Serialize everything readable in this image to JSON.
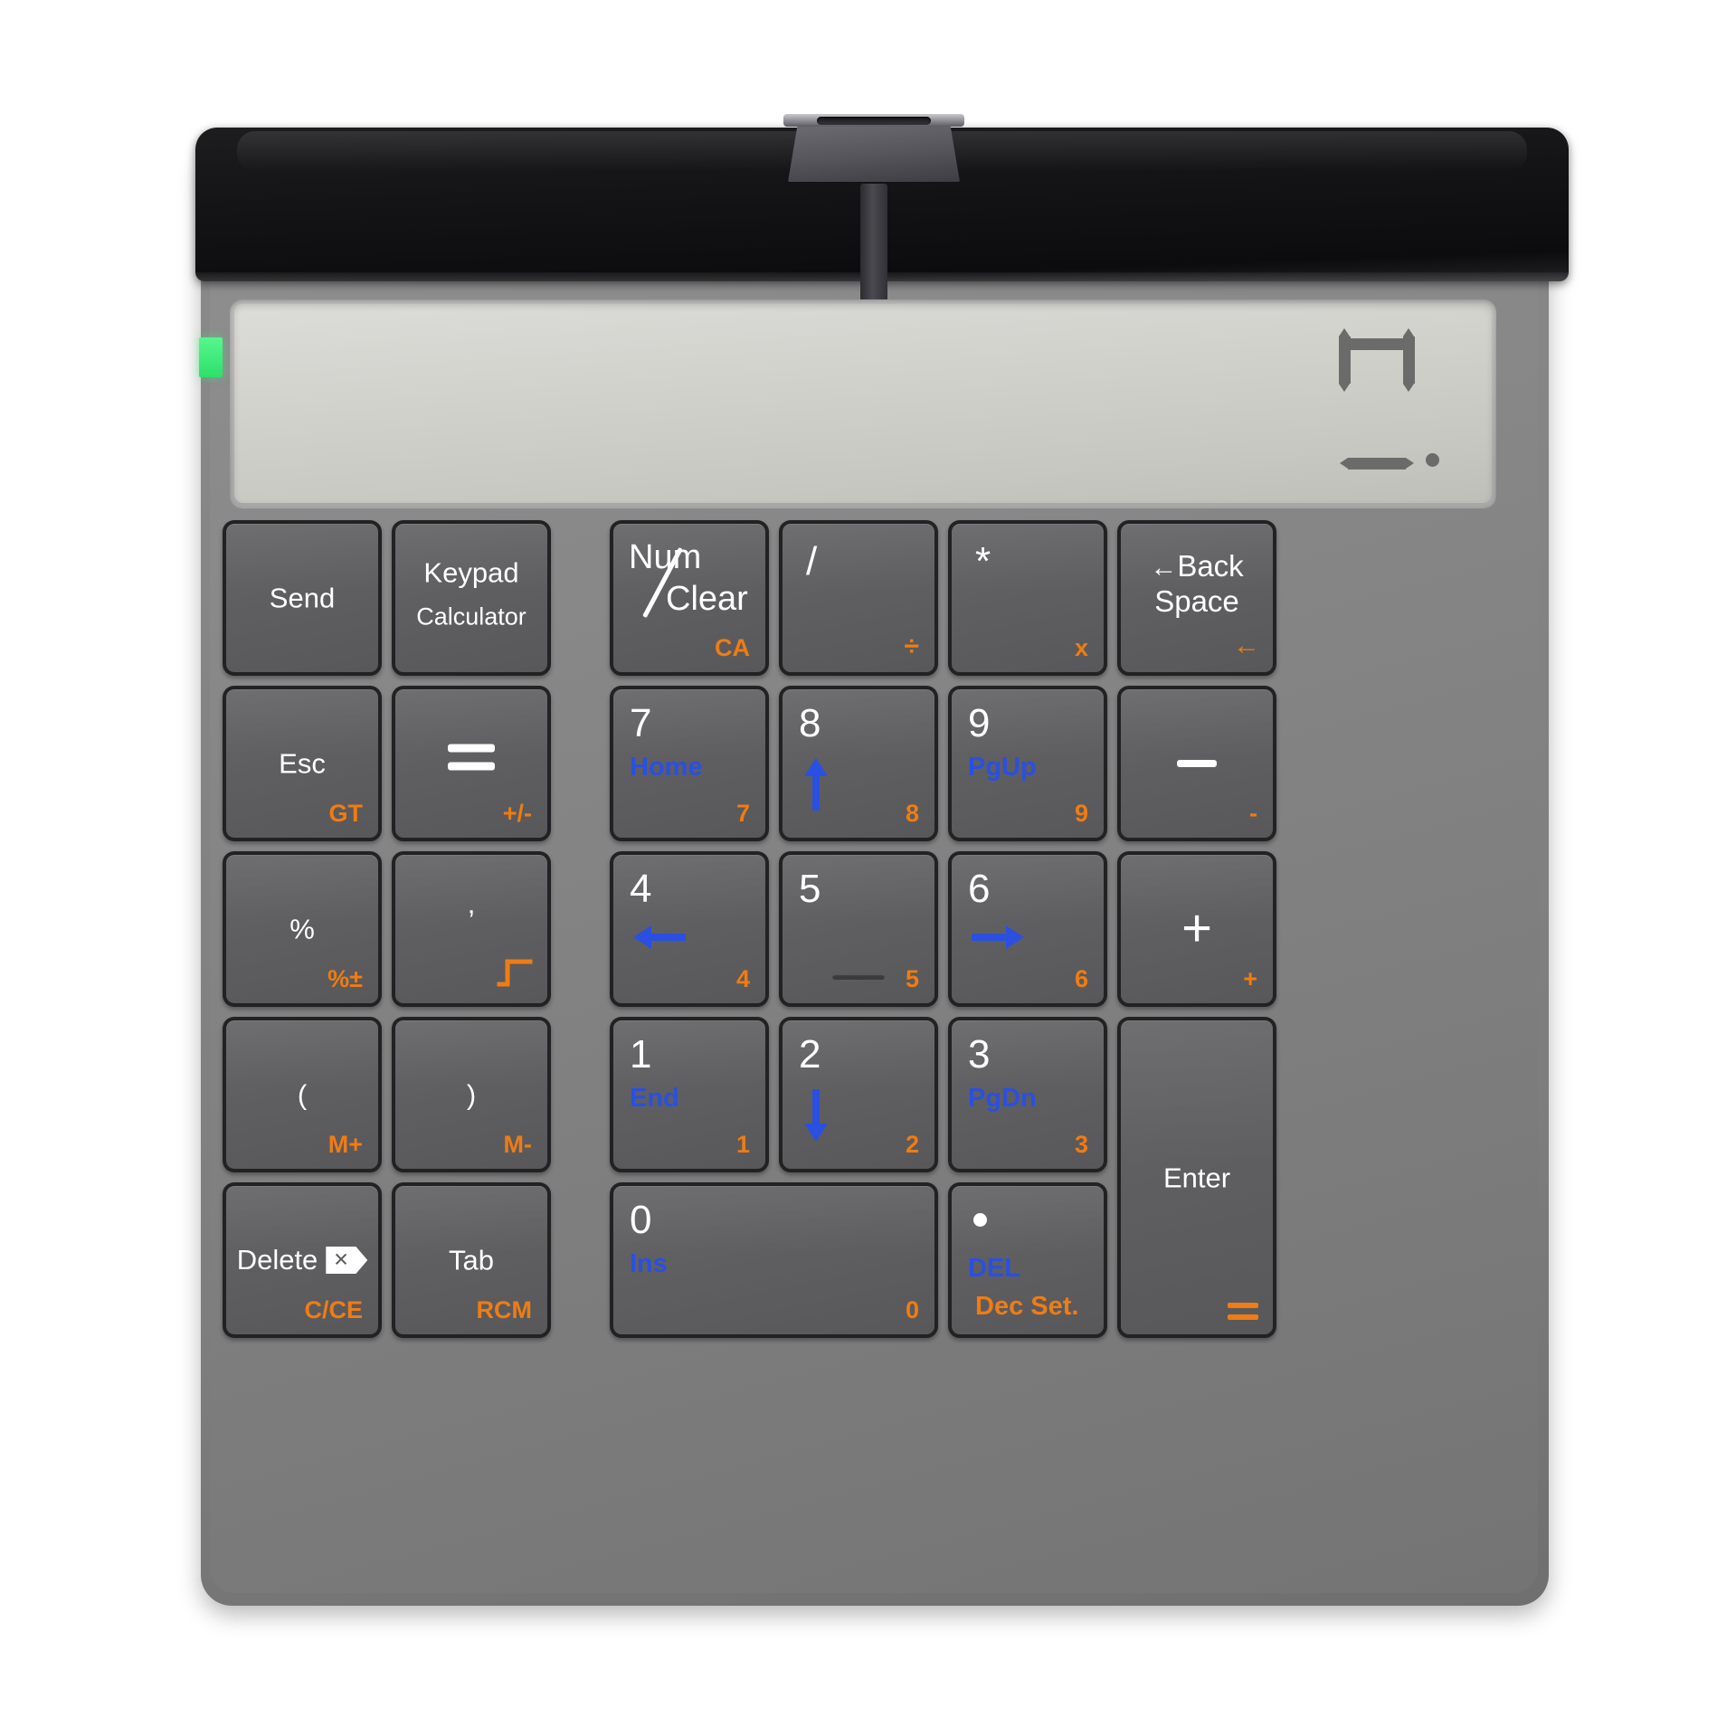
{
  "device": {
    "type": "wireless-numeric-keypad-calculator",
    "power_led_color": "#2ee06a",
    "accent_orange": "#ef7c14",
    "accent_blue": "#2b4fe0",
    "key_face_color": "#5f5f61",
    "body_color": "#848484",
    "top_panel_color": "#141416"
  },
  "display": {
    "value": "0",
    "decimal_point": ".",
    "segment_color": "#6b6b6b",
    "lcd_background": "#d2d2cd"
  },
  "keys": {
    "left_column": [
      {
        "id": "send",
        "primary": "Send",
        "secondary": "",
        "orange": "",
        "blue": ""
      },
      {
        "id": "keypad",
        "primary": "Keypad",
        "secondary": "Calculator",
        "orange": "",
        "blue": ""
      },
      {
        "id": "esc",
        "primary": "Esc",
        "secondary": "",
        "orange": "GT",
        "blue": ""
      },
      {
        "id": "equals",
        "primary": "=",
        "secondary": "",
        "orange": "+/-",
        "blue": ""
      },
      {
        "id": "percent",
        "primary": "%",
        "secondary": "",
        "orange": "%±",
        "blue": ""
      },
      {
        "id": "comma",
        "primary": ",",
        "secondary": "",
        "orange": "√",
        "blue": ""
      },
      {
        "id": "paren-open",
        "primary": "(",
        "secondary": "",
        "orange": "M+",
        "blue": ""
      },
      {
        "id": "paren-close",
        "primary": ")",
        "secondary": "",
        "orange": "M-",
        "blue": ""
      },
      {
        "id": "delete",
        "primary": "Delete",
        "secondary": "",
        "orange": "C/CE",
        "blue": ""
      },
      {
        "id": "tab",
        "primary": "Tab",
        "secondary": "",
        "orange": "RCM",
        "blue": ""
      }
    ],
    "keypad": [
      {
        "id": "num-clear",
        "primary": "Num",
        "secondary": "Clear",
        "orange": "CA",
        "blue": ""
      },
      {
        "id": "divide",
        "primary": "/",
        "secondary": "",
        "orange": "÷",
        "blue": ""
      },
      {
        "id": "multiply",
        "primary": "*",
        "secondary": "",
        "orange": "x",
        "blue": ""
      },
      {
        "id": "backspace",
        "primary": "Back",
        "secondary": "Space",
        "orange": "←",
        "blue": ""
      },
      {
        "id": "num7",
        "primary": "7",
        "secondary": "",
        "orange": "7",
        "blue": "Home"
      },
      {
        "id": "num8",
        "primary": "8",
        "secondary": "",
        "orange": "8",
        "blue": "↑"
      },
      {
        "id": "num9",
        "primary": "9",
        "secondary": "",
        "orange": "9",
        "blue": "PgUp"
      },
      {
        "id": "minus",
        "primary": "−",
        "secondary": "",
        "orange": "-",
        "blue": ""
      },
      {
        "id": "num4",
        "primary": "4",
        "secondary": "",
        "orange": "4",
        "blue": "←"
      },
      {
        "id": "num5",
        "primary": "5",
        "secondary": "",
        "orange": "5",
        "blue": ""
      },
      {
        "id": "num6",
        "primary": "6",
        "secondary": "",
        "orange": "6",
        "blue": "→"
      },
      {
        "id": "plus",
        "primary": "+",
        "secondary": "",
        "orange": "+",
        "blue": ""
      },
      {
        "id": "num1",
        "primary": "1",
        "secondary": "",
        "orange": "1",
        "blue": "End"
      },
      {
        "id": "num2",
        "primary": "2",
        "secondary": "",
        "orange": "2",
        "blue": "↓"
      },
      {
        "id": "num3",
        "primary": "3",
        "secondary": "",
        "orange": "3",
        "blue": "PgDn"
      },
      {
        "id": "enter",
        "primary": "Enter",
        "secondary": "",
        "orange": "=",
        "blue": ""
      },
      {
        "id": "num0",
        "primary": "0",
        "secondary": "",
        "orange": "0",
        "blue": "Ins"
      },
      {
        "id": "decimal",
        "primary": "·",
        "secondary": "",
        "orange": "Dec Set.",
        "blue": "DEL"
      }
    ]
  }
}
